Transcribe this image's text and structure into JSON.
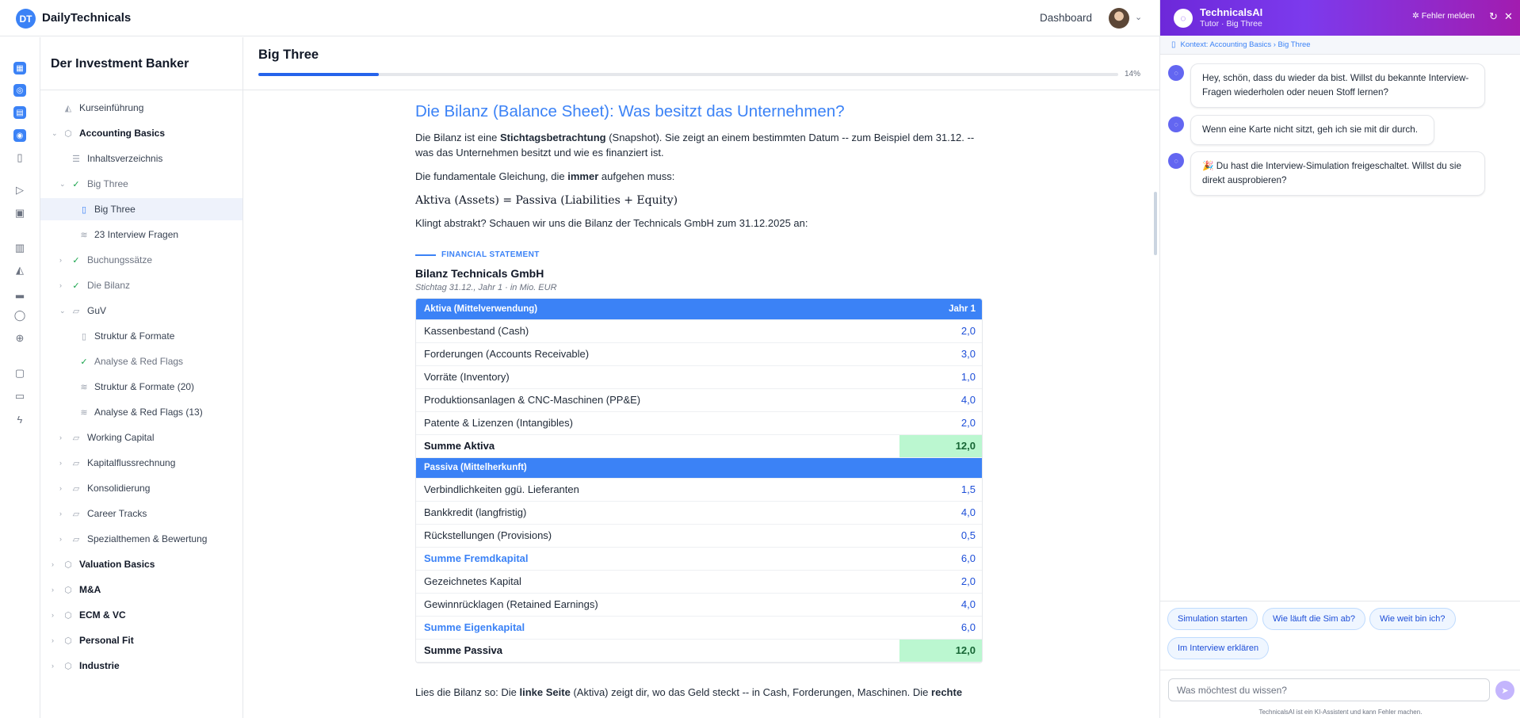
{
  "app": {
    "brand": "DailyTechnicals",
    "logo_text": "DT",
    "nav_link": "Dashboard"
  },
  "rail": {
    "icons": [
      "calendar-icon",
      "compass-icon",
      "document-icon",
      "target-icon",
      "book-icon",
      "play-icon",
      "briefcase-icon",
      "building-icon",
      "graduation-icon",
      "bar-chart-icon",
      "user-icon",
      "lifebuoy-icon",
      "briefcase-small-icon",
      "file-icon",
      "zap-icon"
    ]
  },
  "sidebar": {
    "title": "Der Investment Banker",
    "items": [
      {
        "label": "Kurseinführung",
        "icon": "graduation-icon"
      },
      {
        "label": "Accounting Basics",
        "icon": "package-icon"
      },
      {
        "label": "Inhaltsverzeichnis",
        "icon": "list-icon"
      },
      {
        "label": "Big Three",
        "icon": "check-circle-icon"
      },
      {
        "label": "Big Three",
        "icon": "book-icon"
      },
      {
        "label": "23 Interview Fragen",
        "icon": "layers-icon"
      },
      {
        "label": "Buchungssätze",
        "icon": "check-circle-icon"
      },
      {
        "label": "Die Bilanz",
        "icon": "check-circle-icon"
      },
      {
        "label": "GuV",
        "icon": "folder-icon"
      },
      {
        "label": "Struktur & Formate",
        "icon": "book-icon"
      },
      {
        "label": "Analyse & Red Flags",
        "icon": "check-circle-icon"
      },
      {
        "label": "Struktur & Formate (20)",
        "icon": "layers-icon"
      },
      {
        "label": "Analyse & Red Flags (13)",
        "icon": "layers-icon"
      },
      {
        "label": "Working Capital",
        "icon": "folder-icon"
      },
      {
        "label": "Kapitalflussrechnung",
        "icon": "folder-icon"
      },
      {
        "label": "Konsolidierung",
        "icon": "folder-icon"
      },
      {
        "label": "Career Tracks",
        "icon": "folder-icon"
      },
      {
        "label": "Spezialthemen & Bewertung",
        "icon": "folder-icon"
      },
      {
        "label": "Valuation Basics",
        "icon": "package-icon"
      },
      {
        "label": "M&A",
        "icon": "package-icon"
      },
      {
        "label": "ECM & VC",
        "icon": "package-icon"
      },
      {
        "label": "Personal Fit",
        "icon": "package-icon"
      },
      {
        "label": "Industrie",
        "icon": "package-icon"
      }
    ]
  },
  "page": {
    "title": "Big Three",
    "progress_percent": 14,
    "progress_label": "14%"
  },
  "article": {
    "heading": "Die Bilanz (Balance Sheet): Was besitzt das Unternehmen?",
    "p1_a": "Die Bilanz ist eine ",
    "p1_bold": "Stichtagsbetrachtung",
    "p1_b": " (Snapshot). Sie zeigt an einem bestimmten Datum -- zum Beispiel dem 31.12. -- was das Unternehmen besitzt und wie es finanziert ist.",
    "p2_a": "Die fundamentale Gleichung, die ",
    "p2_bold": "immer",
    "p2_b": " aufgehen muss:",
    "formula": "Aktiva (Assets) = Passiva (Liabilities + Equity)",
    "p3": "Klingt abstrakt? Schauen wir uns die Bilanz der Technicals GmbH zum 31.12.2025 an:",
    "fs_label": "FINANCIAL STATEMENT",
    "fs_title": "Bilanz Technicals GmbH",
    "fs_subtitle": "Stichtag 31.12., Jahr 1 · in Mio. EUR",
    "p4_a": "Lies die Bilanz so: Die ",
    "p4_bold1": "linke Seite",
    "p4_b": " (Aktiva) zeigt dir, wo das Geld steckt -- in Cash, Forderungen, Maschinen. Die ",
    "p4_bold2": "rechte"
  },
  "balance_sheet": {
    "aktiva_header": "Aktiva (Mittelverwendung)",
    "year_header": "Jahr 1",
    "aktiva_rows": [
      {
        "label": "Kassenbestand (Cash)",
        "value": "2,0"
      },
      {
        "label": "Forderungen (Accounts Receivable)",
        "value": "3,0"
      },
      {
        "label": "Vorräte (Inventory)",
        "value": "1,0"
      },
      {
        "label": "Produktionsanlagen & CNC-Maschinen (PP&E)",
        "value": "4,0"
      },
      {
        "label": "Patente & Lizenzen (Intangibles)",
        "value": "2,0"
      }
    ],
    "aktiva_sum": {
      "label": "Summe Aktiva",
      "value": "12,0"
    },
    "passiva_header": "Passiva (Mittelherkunft)",
    "fk_rows": [
      {
        "label": "Verbindlichkeiten ggü. Lieferanten",
        "value": "1,5"
      },
      {
        "label": "Bankkredit (langfristig)",
        "value": "4,0"
      },
      {
        "label": "Rückstellungen (Provisions)",
        "value": "0,5"
      }
    ],
    "fk_sum": {
      "label": "Summe Fremdkapital",
      "value": "6,0"
    },
    "ek_rows": [
      {
        "label": "Gezeichnetes Kapital",
        "value": "2,0"
      },
      {
        "label": "Gewinnrücklagen (Retained Earnings)",
        "value": "4,0"
      }
    ],
    "ek_sum": {
      "label": "Summe Eigenkapital",
      "value": "6,0"
    },
    "passiva_sum": {
      "label": "Summe Passiva",
      "value": "12,0"
    }
  },
  "chat": {
    "title": "TechnicalsAI",
    "subtitle": "Tutor · Big Three",
    "report_label": "Fehler melden",
    "context": "Kontext: Accounting Basics › Big Three",
    "messages": [
      "Hey, schön, dass du wieder da bist. Willst du bekannte Interview-Fragen wiederholen oder neuen Stoff lernen?",
      "Wenn eine Karte nicht sitzt, geh ich sie mit dir durch.",
      "🎉 Du hast die Interview-Simulation freigeschaltet. Willst du sie direkt ausprobieren?"
    ],
    "quick_replies": [
      "Simulation starten",
      "Wie läuft die Sim ab?",
      "Wie weit bin ich?",
      "Im Interview erklären"
    ],
    "input_placeholder": "Was möchtest du wissen?",
    "disclaimer": "TechnicalsAI ist ein KI-Assistent und kann Fehler machen."
  },
  "colors": {
    "accent": "#3b82f6",
    "chat_gradient_start": "#6d28d9",
    "sum_highlight": "#bbf7d0",
    "check": "#16a34a"
  }
}
